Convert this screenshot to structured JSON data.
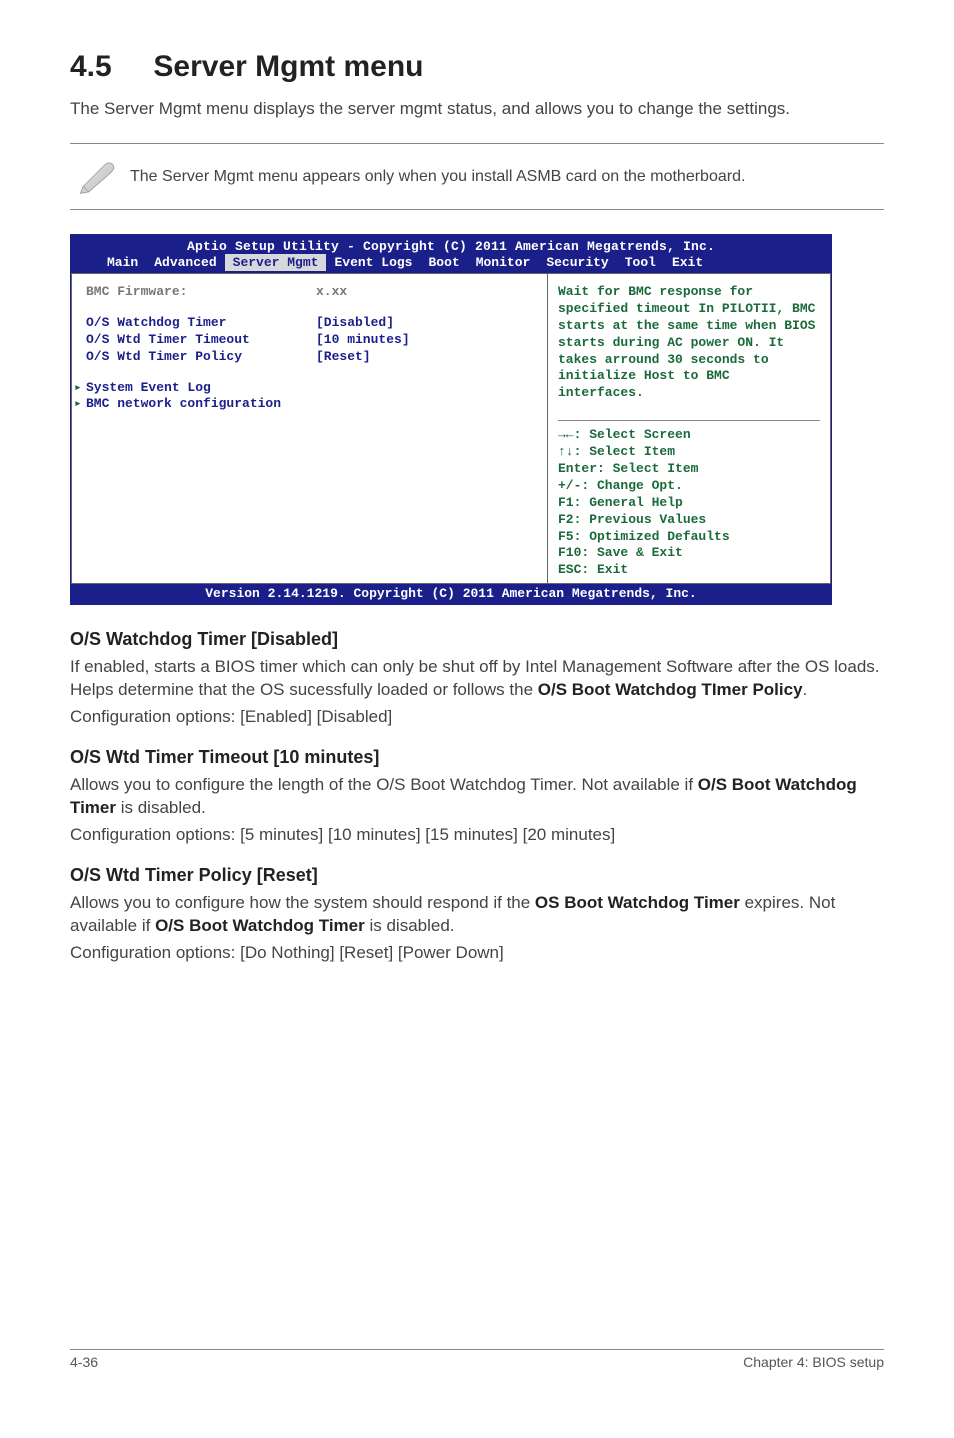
{
  "section": {
    "number": "4.5",
    "title": "Server Mgmt menu"
  },
  "intro": "The Server Mgmt menu displays the server mgmt status, and allows you to change the settings.",
  "note": "The Server Mgmt menu appears only when you install ASMB card on the motherboard.",
  "bios": {
    "header": "Aptio Setup Utility - Copyright (C) 2011 American Megatrends, Inc.",
    "tabs": [
      "Main",
      "Advanced",
      "Server Mgmt",
      "Event Logs",
      "Boot",
      "Monitor",
      "Security",
      "Tool",
      "Exit"
    ],
    "selected_tab": "Server Mgmt",
    "rows": [
      {
        "label": "BMC Firmware:",
        "value": "x.xx",
        "style": "gray"
      },
      {
        "spacer": true
      },
      {
        "label": "O/S Watchdog Timer",
        "value": "[Disabled]"
      },
      {
        "label": "O/S Wtd Timer Timeout",
        "value": "[10 minutes]"
      },
      {
        "label": "O/S Wtd Timer Policy",
        "value": "[Reset]"
      },
      {
        "spacer": true
      },
      {
        "submenu": "System Event Log"
      },
      {
        "submenu": "BMC network configuration"
      }
    ],
    "help": "Wait for BMC response for specified timeout In PILOTII, BMC starts at the same time when BIOS starts during AC power ON. It takes arround 30 seconds to initialize Host to BMC interfaces.",
    "legend": "→←: Select Screen\n↑↓:  Select Item\nEnter: Select Item\n+/-: Change Opt.\nF1: General Help\nF2: Previous Values\nF5: Optimized Defaults\nF10: Save & Exit\nESC: Exit",
    "footer": "Version 2.14.1219. Copyright (C) 2011 American Megatrends, Inc."
  },
  "options": [
    {
      "title": "O/S Watchdog Timer [Disabled]",
      "body_pre": "If enabled, starts a BIOS timer which can only be shut off by Intel Management Software after the OS loads. Helps determine that the OS sucessfully loaded or follows the ",
      "body_bold": "O/S Boot Watchdog TImer Policy",
      "body_post": ".",
      "config": "Configuration options: [Enabled] [Disabled]"
    },
    {
      "title": "O/S Wtd Timer Timeout [10 minutes]",
      "body_pre": "Allows you to configure the length of the O/S Boot Watchdog Timer. Not available if ",
      "body_bold": "O/S Boot Watchdog Timer",
      "body_post": " is disabled.",
      "config": "Configuration options: [5 minutes] [10 minutes] [15 minutes] [20 minutes]"
    },
    {
      "title": "O/S Wtd Timer Policy [Reset]",
      "body_pre": "Allows you to configure how the system should respond if the ",
      "body_bold": "OS Boot Watchdog Timer",
      "body_mid": " expires. Not available if ",
      "body_bold2": "O/S Boot Watchdog Timer",
      "body_post": " is disabled.",
      "config": "Configuration options: [Do Nothing] [Reset] [Power Down]"
    }
  ],
  "footer": {
    "left": "4-36",
    "right": "Chapter 4: BIOS setup"
  }
}
